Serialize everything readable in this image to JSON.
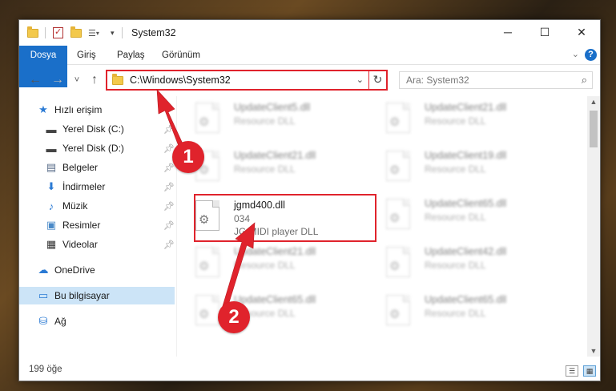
{
  "window": {
    "title": "System32"
  },
  "titlebar": {
    "minimize": "─",
    "maximize": "☐",
    "close": "✕",
    "qa_dropdown": "▾"
  },
  "ribbon": {
    "tabs": [
      "Dosya",
      "Giriş",
      "Paylaş",
      "Görünüm"
    ],
    "help": "?",
    "expand": "⌄"
  },
  "nav": {
    "back": "←",
    "forward": "→",
    "recent": "˅",
    "up": "↑",
    "address": "C:\\Windows\\System32",
    "address_dropdown": "⌄",
    "refresh": "↻",
    "search_placeholder": "Ara: System32"
  },
  "sidebar": {
    "items": [
      {
        "label": "Hızlı erişim",
        "icon": "star-icon"
      },
      {
        "label": "Yerel Disk (C:)",
        "icon": "drive-icon",
        "pinned": true
      },
      {
        "label": "Yerel Disk (D:)",
        "icon": "drive-icon",
        "pinned": true
      },
      {
        "label": "Belgeler",
        "icon": "document-icon",
        "pinned": true
      },
      {
        "label": "İndirmeler",
        "icon": "download-icon",
        "pinned": true
      },
      {
        "label": "Müzik",
        "icon": "music-icon",
        "pinned": true
      },
      {
        "label": "Resimler",
        "icon": "pictures-icon",
        "pinned": true
      },
      {
        "label": "Videolar",
        "icon": "video-icon",
        "pinned": true
      },
      {
        "label": "OneDrive",
        "icon": "cloud-icon"
      },
      {
        "label": "Bu bilgisayar",
        "icon": "computer-icon",
        "selected": true
      },
      {
        "label": "Ağ",
        "icon": "network-icon"
      }
    ]
  },
  "files": {
    "left": [
      {
        "name": "UpdateClient5.dll",
        "desc": "Resource DLL"
      },
      {
        "name": "UpdateClient21.dll",
        "desc": "Resource DLL"
      },
      {
        "name": "jgmd400.dll",
        "line2": "034",
        "desc": "JG MIDI player DLL",
        "highlighted": true
      },
      {
        "name": "UpdateClient21.dll",
        "desc": "Resource DLL"
      },
      {
        "name": "UpdateClient65.dll",
        "desc": "Resource DLL"
      }
    ],
    "right": [
      {
        "name": "UpdateClient21.dll",
        "desc": "Resource DLL"
      },
      {
        "name": "UpdateClient19.dll",
        "desc": "Resource DLL"
      },
      {
        "name": "UpdateClient65.dll",
        "desc": "Resource DLL"
      },
      {
        "name": "UpdateClient42.dll",
        "desc": "Resource DLL"
      },
      {
        "name": "UpdateClient65.dll",
        "desc": "Resource DLL"
      }
    ]
  },
  "status": {
    "count": "199 öğe"
  },
  "callouts": {
    "one": "1",
    "two": "2"
  },
  "colors": {
    "accent": "#1a6fc9",
    "highlight": "#e0232c",
    "selection": "#cce4f7"
  }
}
